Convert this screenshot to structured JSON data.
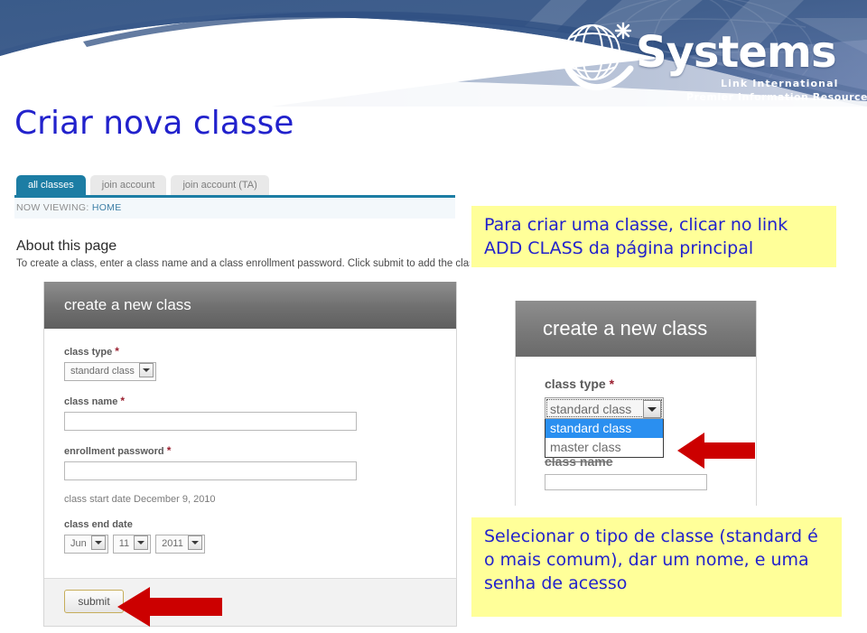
{
  "slide": {
    "title": "Criar nova classe"
  },
  "banner": {
    "logo_word": "Systems",
    "logo_sub1": "Link International",
    "logo_sub2": "Premier Information Resources",
    "bg_color": "#3b5d8c",
    "accent_color": "#ffffff"
  },
  "screenshot_left": {
    "tabs": [
      {
        "label": "all classes",
        "active": true
      },
      {
        "label": "join account",
        "active": false
      },
      {
        "label": "join account (TA)",
        "active": false
      }
    ],
    "now_viewing_prefix": "NOW VIEWING:",
    "now_viewing_value": "HOME",
    "about_heading": "About this page",
    "about_text": "To create a class, enter a class name and a class enrollment password. Click submit to add the clas",
    "card": {
      "title": "create a new class",
      "class_type_label": "class type",
      "class_type_value": "standard class",
      "class_name_label": "class name",
      "class_name_value": "",
      "enrollment_password_label": "enrollment password",
      "enrollment_password_value": "",
      "class_start_date_label": "class start date",
      "class_start_date_value": "December 9, 2010",
      "class_end_date_label": "class end date",
      "end_month": "Jun",
      "end_day": "11",
      "end_year": "2011",
      "submit_label": "submit",
      "required_marker": "*"
    }
  },
  "screenshot_right": {
    "card_title": "create a new class",
    "class_type_label": "class type",
    "required_marker": "*",
    "selected_value": "standard class",
    "options": [
      {
        "label": "standard class",
        "selected": true
      },
      {
        "label": "master class",
        "selected": false
      }
    ],
    "ghost_label": "class name",
    "highlight_color": "#2a8ff0"
  },
  "callouts": {
    "top": "Para criar uma classe, clicar no link ADD CLASS da página principal",
    "bottom": "Selecionar o tipo de classe (standard é o mais comum), dar um nome, e uma senha de acesso",
    "bg_color": "#ffff99",
    "text_color": "#2222cc"
  },
  "arrows": {
    "color": "#cc0000",
    "submit_arrow_name": "arrow-pointing-to-submit",
    "dropdown_arrow_name": "arrow-pointing-to-dropdown"
  }
}
